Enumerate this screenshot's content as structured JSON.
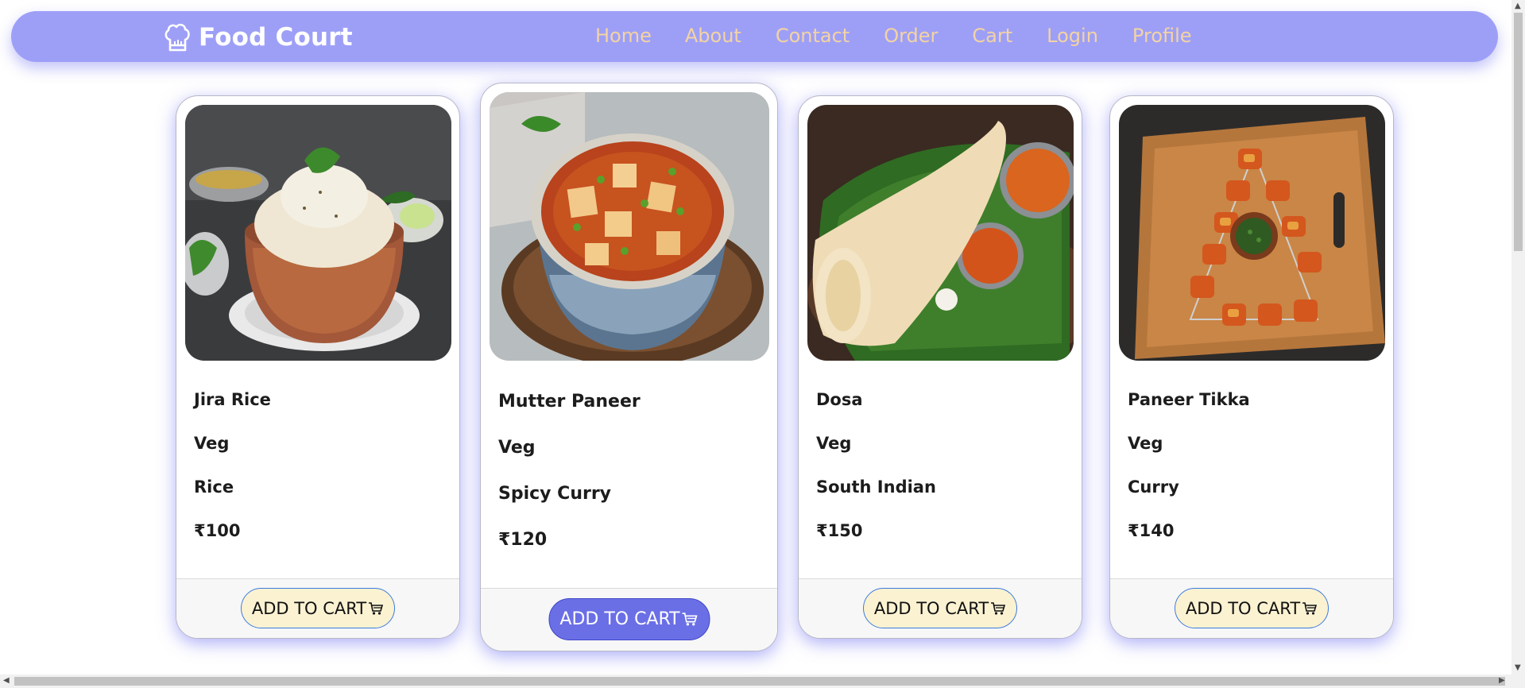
{
  "brand": {
    "name": "Food Court",
    "icon": "chef-hat-icon"
  },
  "nav": {
    "links": [
      "Home",
      "About",
      "Contact",
      "Order",
      "Cart",
      "Login",
      "Profile"
    ]
  },
  "colors": {
    "navbar": "#9d9ff7",
    "nav_link": "#f3d3a3",
    "button_default": "#fbf2d2",
    "button_active": "#6b6fe6",
    "shadow": "#7c7ff0"
  },
  "cards": [
    {
      "name": "Jira Rice",
      "type": "Veg",
      "category": "Rice",
      "price": "₹100",
      "button": "ADD TO CART",
      "image": "jira-rice-photo",
      "active": false
    },
    {
      "name": "Mutter Paneer",
      "type": "Veg",
      "category": "Spicy Curry",
      "price": "₹120",
      "button": "ADD TO CART",
      "image": "mutter-paneer-photo",
      "active": true
    },
    {
      "name": "Dosa",
      "type": "Veg",
      "category": "South Indian",
      "price": "₹150",
      "button": "ADD TO CART",
      "image": "dosa-photo",
      "active": false
    },
    {
      "name": "Paneer Tikka",
      "type": "Veg",
      "category": "Curry",
      "price": "₹140",
      "button": "ADD TO CART",
      "image": "paneer-tikka-photo",
      "active": false
    }
  ]
}
